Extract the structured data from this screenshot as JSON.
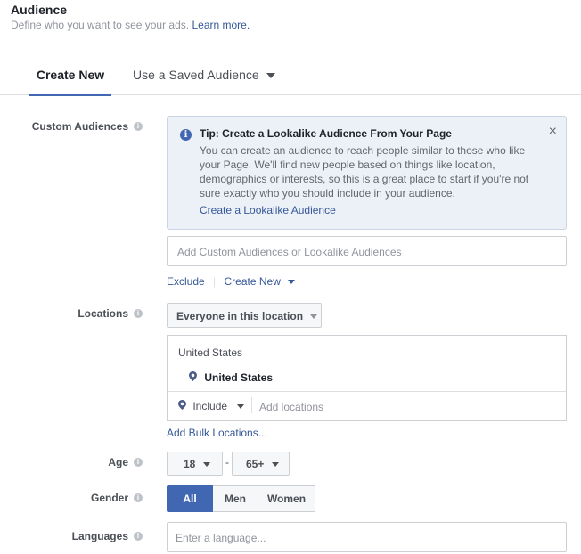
{
  "header": {
    "title": "Audience",
    "subtitle": "Define who you want to see your ads.",
    "learn_more": "Learn more."
  },
  "tabs": {
    "create_new": "Create New",
    "saved": "Use a Saved Audience"
  },
  "custom_audiences": {
    "label": "Custom Audiences",
    "tip": {
      "title": "Tip: Create a Lookalike Audience From Your Page",
      "line1": "You can create an audience to reach people similar to those who like",
      "line2": "your Page. We'll find new people based on things like location,",
      "line3": "demographics or interests, so this is a great place to start if you're not",
      "line4": "sure exactly who you should include in your audience.",
      "link": "Create a Lookalike Audience",
      "close": "×"
    },
    "input_placeholder": "Add Custom Audiences or Lookalike Audiences",
    "exclude": "Exclude",
    "create_new": "Create New"
  },
  "locations": {
    "label": "Locations",
    "selector": "Everyone in this location",
    "country_header": "United States",
    "selected": "United States",
    "include": "Include",
    "add_placeholder": "Add locations",
    "bulk": "Add Bulk Locations..."
  },
  "age": {
    "label": "Age",
    "min": "18",
    "separator": "-",
    "max": "65+"
  },
  "gender": {
    "label": "Gender",
    "all": "All",
    "men": "Men",
    "women": "Women",
    "selected": "All"
  },
  "languages": {
    "label": "Languages",
    "placeholder": "Enter a language..."
  },
  "colors": {
    "accent": "#4267b2",
    "link": "#365899",
    "tip_bg": "#ecf0f7"
  },
  "info_glyph": "i"
}
